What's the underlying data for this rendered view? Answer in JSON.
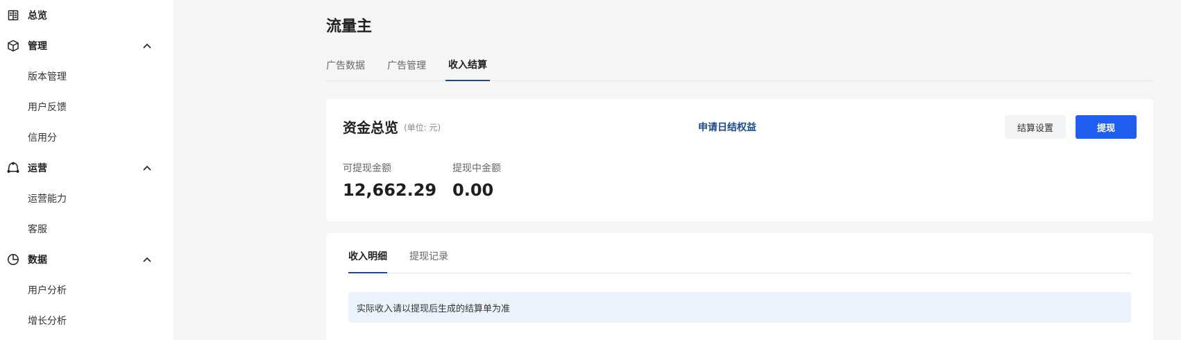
{
  "sidebar": {
    "groups": [
      {
        "label": "总览",
        "icon": "overview-icon"
      },
      {
        "label": "管理",
        "icon": "cube-icon",
        "items": [
          "版本管理",
          "用户反馈",
          "信用分"
        ]
      },
      {
        "label": "运营",
        "icon": "operation-icon",
        "items": [
          "运营能力",
          "客服"
        ]
      },
      {
        "label": "数据",
        "icon": "pie-chart-icon",
        "items": [
          "用户分析",
          "增长分析"
        ]
      }
    ]
  },
  "page": {
    "title": "流量主",
    "tabs": [
      {
        "label": "广告数据",
        "active": false
      },
      {
        "label": "广告管理",
        "active": false
      },
      {
        "label": "收入结算",
        "active": true
      }
    ]
  },
  "funds": {
    "title": "资金总览",
    "unit": "(单位: 元)",
    "apply_link": "申请日结权益",
    "settings_button": "结算设置",
    "withdraw_button": "提现",
    "available_label": "可提现金额",
    "available_value": "12,662.29",
    "pending_label": "提现中金额",
    "pending_value": "0.00"
  },
  "details": {
    "tabs": [
      {
        "label": "收入明细",
        "active": true
      },
      {
        "label": "提现记录",
        "active": false
      }
    ],
    "notice": "实际收入请以提现后生成的结算单为准"
  },
  "colors": {
    "accent": "#1f5ff0",
    "link": "#1a4a8a",
    "notice_bg": "#ebf3fc"
  }
}
